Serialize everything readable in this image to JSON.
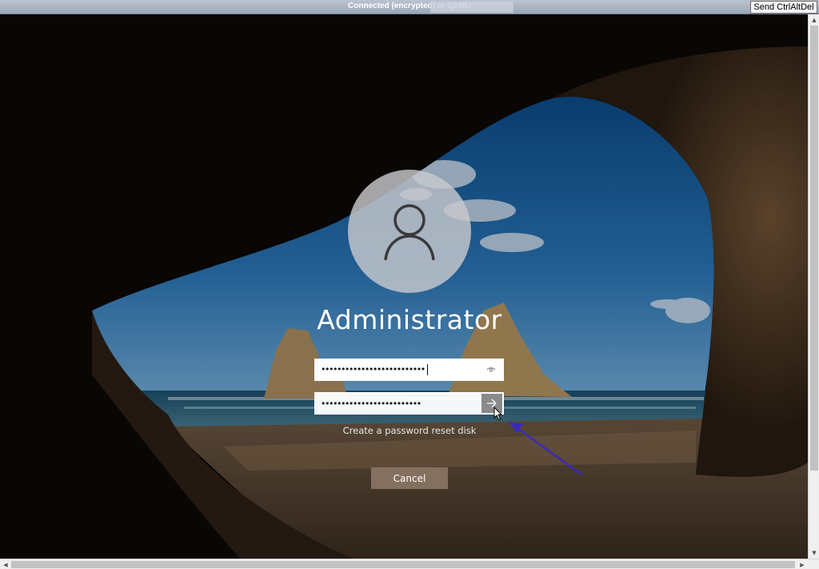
{
  "topbar": {
    "title": "Connected (encrypted) to QEMU",
    "send_cad_label": "Send CtrlAltDel"
  },
  "login": {
    "username": "Administrator",
    "password_field_1": {
      "value": "••••••••••••••••••••••••••"
    },
    "password_field_2": {
      "value": "•••••••••••••••••••••••••"
    },
    "reset_link": "Create a password reset disk",
    "cancel_label": "Cancel"
  },
  "icons": {
    "avatar": "user-icon",
    "reveal": "eye-icon",
    "submit": "arrow-right-icon"
  },
  "colors": {
    "text": "#ffffff",
    "annotation_arrow": "#3a2bb8",
    "submit_button": "#8a8a8a"
  }
}
